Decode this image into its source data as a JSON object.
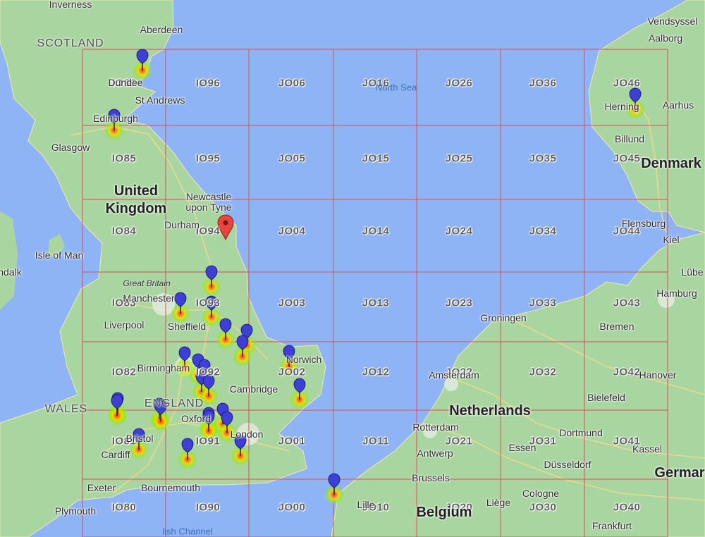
{
  "colors": {
    "sea": "#8fb4f5",
    "land": "#a9d5a0",
    "grid": "#d94f52",
    "pin_blue": "#3d3fd6",
    "pin_red": "#e8453c"
  },
  "countries": [
    {
      "name": "United",
      "key": "united-kingdom-line1"
    },
    {
      "name": "Kingdom",
      "key": "united-kingdom-line2"
    },
    {
      "name": "Denmark",
      "key": "denmark"
    },
    {
      "name": "Netherlands",
      "key": "netherlands"
    },
    {
      "name": "Belgium",
      "key": "belgium"
    },
    {
      "name": "Germar",
      "key": "germany"
    }
  ],
  "regions": [
    "SCOTLAND",
    "WALES",
    "ENGLAND"
  ],
  "seas": [
    "North Sea",
    "lish Channel"
  ],
  "cities": [
    "Inverness",
    "Aberdeen",
    "Dundee",
    "St Andrews",
    "Edinburgh",
    "Glasgow",
    "Newcastle",
    "upon Tyne",
    "Durham",
    "Isle of Man",
    "Great Britain",
    "Manchester",
    "Liverpool",
    "Sheffield",
    "Birmingham",
    "Cambridge",
    "Norwich",
    "Oxford",
    "London",
    "Bristol",
    "Cardiff",
    "Exeter",
    "Bournemouth",
    "Plymouth",
    "Vendsyssel",
    "Aalborg",
    "Herning",
    "Aarhus",
    "Billund",
    "Flensburg",
    "Kiel",
    "Lübe",
    "Hamburg",
    "Bremen",
    "Groningen",
    "Amsterdam",
    "Rotterdam",
    "Antwerp",
    "Brussels",
    "Lille",
    "Liège",
    "Dortmund",
    "Essen",
    "Düsseldorf",
    "Cologne",
    "Bielefeld",
    "Hanover",
    "Kassel",
    "Frankfurt",
    "ndalk"
  ],
  "grid_squares": [
    [
      "IO86",
      "IO96",
      "JO06",
      "JO16",
      "JO26",
      "JO36",
      "JO46"
    ],
    [
      "IO85",
      "IO95",
      "JO05",
      "JO15",
      "JO25",
      "JO35",
      "JO45"
    ],
    [
      "IO84",
      "IO94",
      "JO04",
      "JO14",
      "JO24",
      "JO34",
      "JO44"
    ],
    [
      "IO83",
      "IO93",
      "JO03",
      "JO13",
      "JO23",
      "JO33",
      "JO43"
    ],
    [
      "IO82",
      "IO92",
      "JO02",
      "JO12",
      "JO22",
      "JO32",
      "JO42"
    ],
    [
      "IO81",
      "IO91",
      "JO01",
      "JO11",
      "JO21",
      "JO31",
      "JO41"
    ],
    [
      "IO80",
      "IO90",
      "JO00",
      "JO10",
      "JO20",
      "JO30",
      "JO40"
    ]
  ],
  "station_count": 28,
  "home_marker_count": 1
}
